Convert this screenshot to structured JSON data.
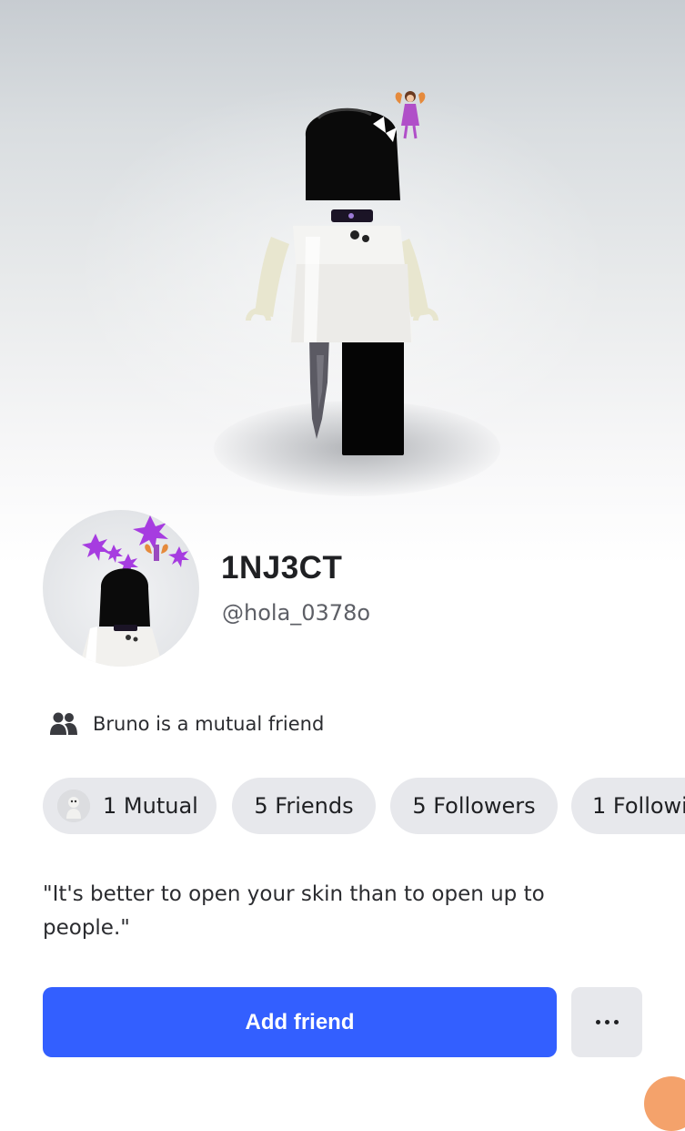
{
  "profile": {
    "display_name": "1NJ3CT",
    "username": "@hola_0378o"
  },
  "mutual_friend": {
    "icon": "friends-icon",
    "text": "Bruno is a mutual friend"
  },
  "stats": [
    {
      "label": "1 Mutual"
    },
    {
      "label": "5 Friends"
    },
    {
      "label": "5 Followers"
    },
    {
      "label": "1 Followi"
    }
  ],
  "bio": "\"It's better to open your skin than to open up to people.\"",
  "actions": {
    "add_friend_label": "Add friend",
    "more_icon": "more-horizontal-icon"
  },
  "colors": {
    "primary_button": "#335fff",
    "pill_background": "#e7e8ec",
    "text_primary": "#1f2023",
    "text_secondary": "#5d5f66"
  }
}
